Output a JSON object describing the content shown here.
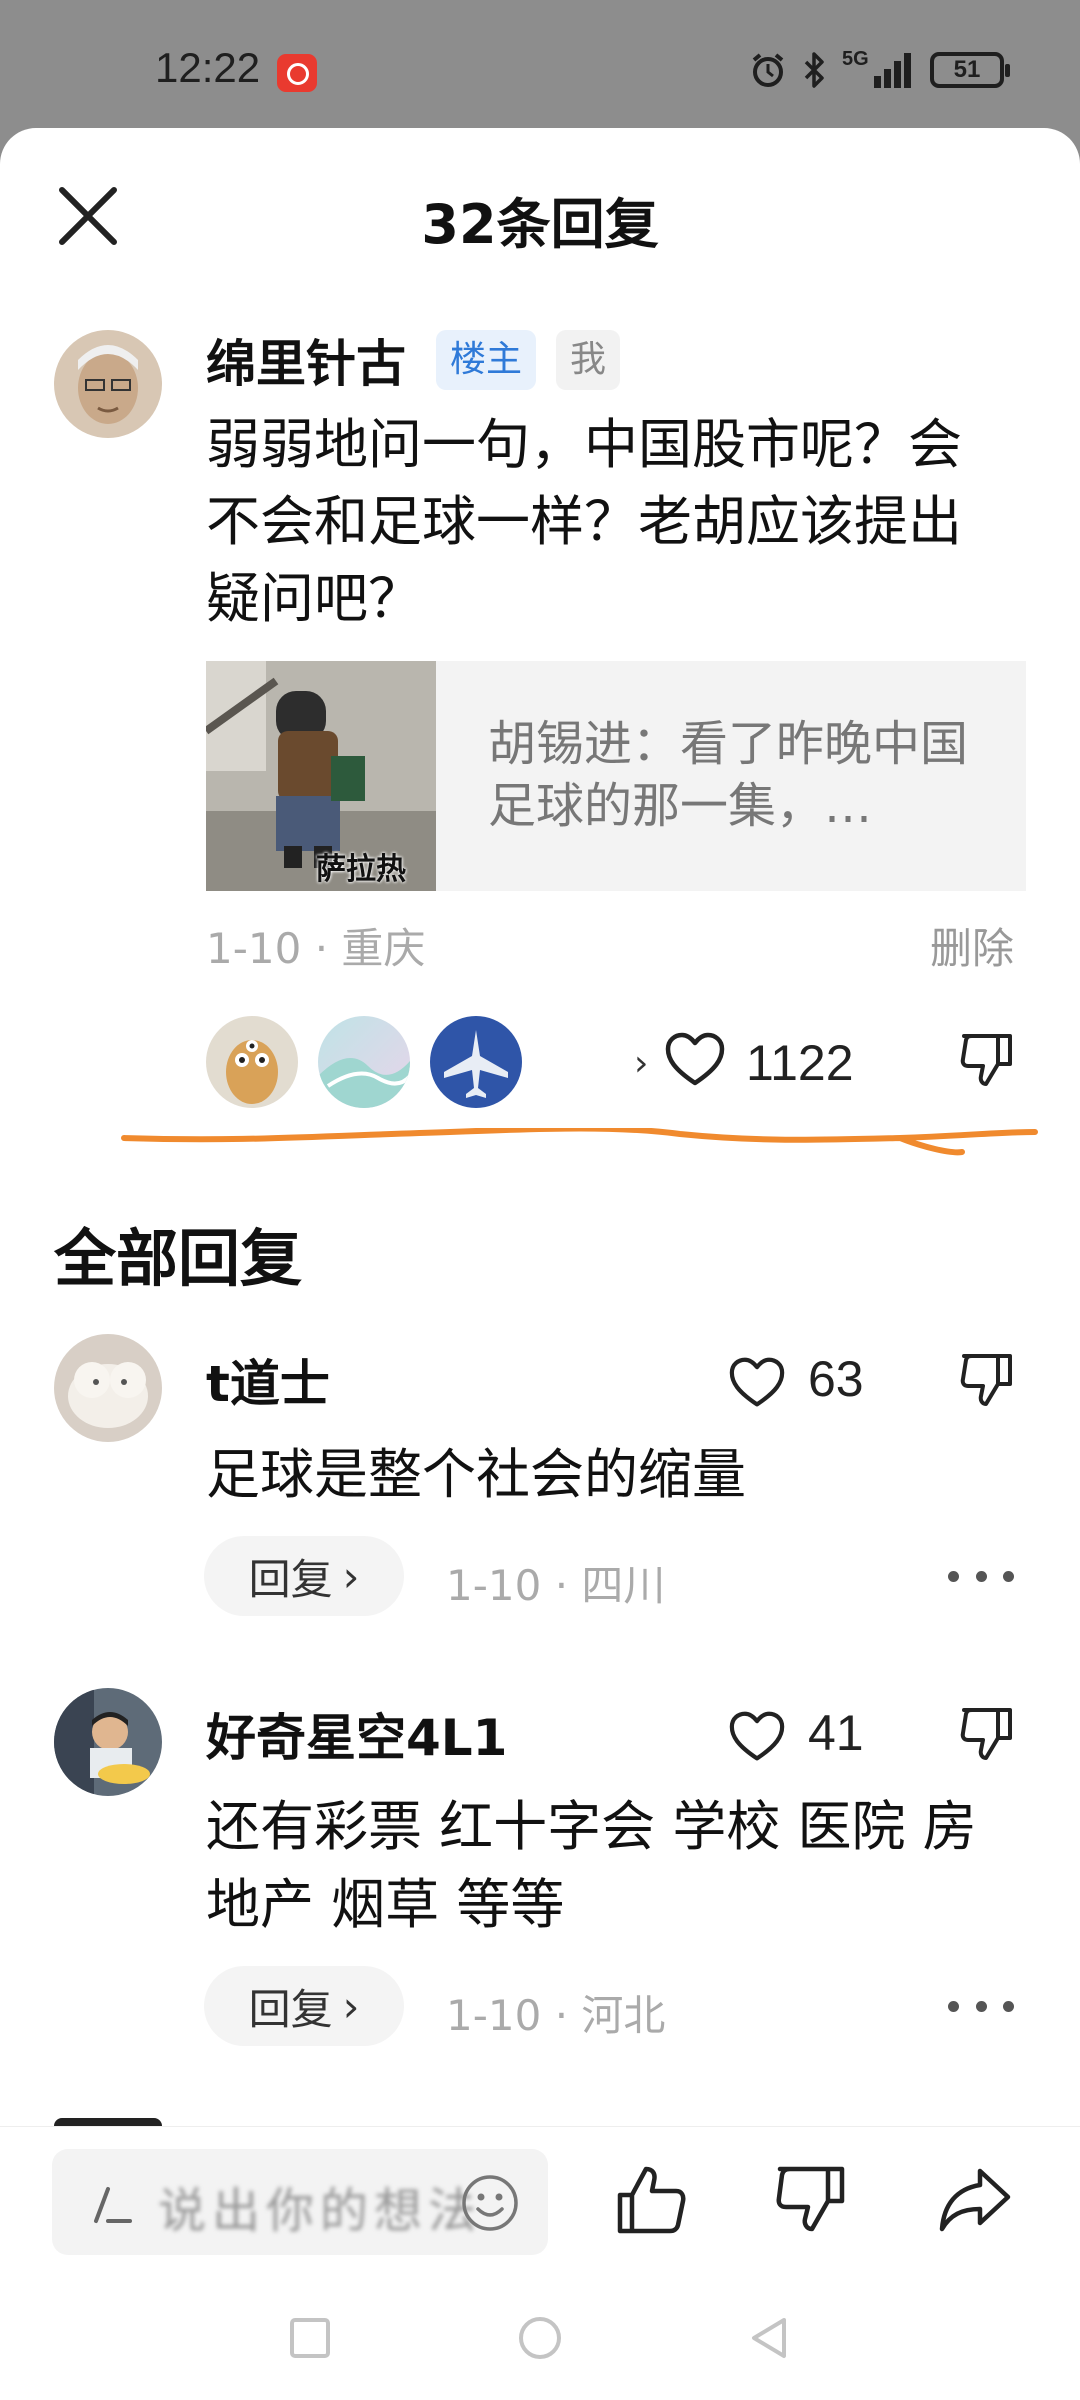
{
  "status_bar": {
    "time": "12:22",
    "network": "5G",
    "battery": "51"
  },
  "sheet": {
    "title": "32条回复",
    "close_icon": "close-icon"
  },
  "main_comment": {
    "author": "绵里针古",
    "tag_owner": "楼主",
    "tag_me": "我",
    "text": "弱弱地问一句，中国股市呢？会不会和足球一样？老胡应该提出疑问吧？",
    "quote": {
      "thumb_caption": "萨拉热",
      "text": "胡锡进：看了昨晚中国足球的那一集，…"
    },
    "date": "1-10",
    "location": "重庆",
    "delete_label": "删除",
    "likes": "1122"
  },
  "section_title": "全部回复",
  "replies": [
    {
      "author": "t道士",
      "text": "足球是整个社会的缩量",
      "likes": "63",
      "reply_label": "回复",
      "date": "1-10",
      "location": "四川"
    },
    {
      "author": "好奇星空4L1",
      "text": "还有彩票 红十字会 学校 医院 房地产 烟草 等等",
      "likes": "41",
      "reply_label": "回复",
      "date": "1-10",
      "location": "河北"
    }
  ],
  "bottom_bar": {
    "input_placeholder": "说出你的想法"
  },
  "colors": {
    "accent_blue": "#2f7ad8",
    "annotation_orange": "#f08a2e",
    "status_gray": "#8d8d8d"
  }
}
